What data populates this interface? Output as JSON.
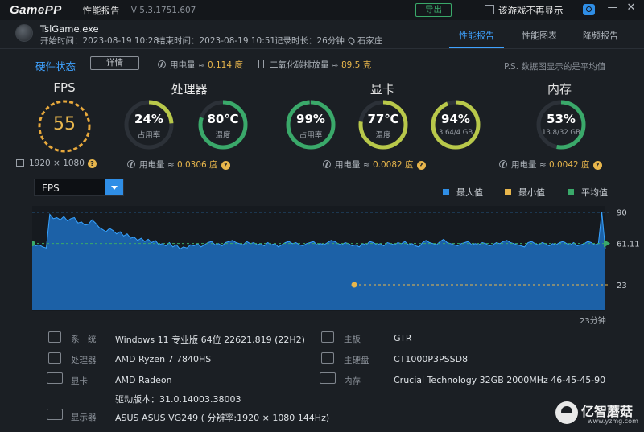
{
  "titlebar": {
    "logo": "GamePP",
    "title": "性能报告",
    "version": "V 5.3.1751.607",
    "export_label": "导出",
    "hide_label": "该游戏不再显示",
    "minimize": "—",
    "close": "✕"
  },
  "game": {
    "name": "TslGame.exe",
    "start": "开始时间：2023-08-19 10:28",
    "end": "结束时间：2023-08-19 10:51",
    "duration": "记录时长：26分钟",
    "location": "石家庄"
  },
  "tabs": [
    {
      "label": "性能报告"
    },
    {
      "label": "性能图表"
    },
    {
      "label": "降频报告"
    }
  ],
  "hardware": {
    "title": "硬件状态",
    "detail_label": "详情",
    "power_text": "用电量 ≈ ",
    "power_value": "0.114 度",
    "co2_text": "二氧化碳排放量 ≈ ",
    "co2_value": "89.5 克",
    "note": "P.S. 数据图显示的是平均值"
  },
  "sections": {
    "fps": "FPS",
    "cpu": "处理器",
    "gpu": "显卡",
    "mem": "内存"
  },
  "gauges": {
    "fps": {
      "value": "55"
    },
    "cpu_usage": {
      "value": "24%",
      "label": "占用率",
      "fraction": 0.24
    },
    "cpu_temp": {
      "value": "80℃",
      "label": "温度",
      "fraction": 0.8
    },
    "gpu_usage": {
      "value": "99%",
      "label": "占用率",
      "fraction": 0.99
    },
    "gpu_temp": {
      "value": "77℃",
      "label": "温度",
      "fraction": 0.77
    },
    "vram": {
      "value": "94%",
      "label": "3.64/4 GB",
      "fraction": 0.94
    },
    "mem": {
      "value": "53%",
      "label": "13.8/32 GB",
      "fraction": 0.53
    }
  },
  "resolution": "1920 × 1080",
  "power": {
    "label": "用电量 ≈ ",
    "cpu": "0.0306 度",
    "gpu": "0.0082 度",
    "mem": "0.0042 度"
  },
  "chart": {
    "selector": "FPS",
    "legend": [
      {
        "label": "最大值",
        "color": "#2f8ee6"
      },
      {
        "label": "最小值",
        "color": "#e8b64c"
      },
      {
        "label": "平均值",
        "color": "#3aa96a"
      }
    ],
    "time_label": "23分钟"
  },
  "chart_data": {
    "type": "area",
    "series": [
      {
        "name": "FPS",
        "values": [
          61,
          59,
          60,
          58,
          57,
          88,
          84,
          85,
          83,
          86,
          82,
          84,
          85,
          80,
          81,
          78,
          79,
          83,
          80,
          76,
          74,
          72,
          75,
          73,
          70,
          72,
          68,
          70,
          66,
          67,
          64,
          66,
          63,
          65,
          62,
          64,
          60,
          61,
          59,
          62,
          58,
          60,
          56,
          58,
          57,
          60,
          59,
          61,
          58,
          60,
          62,
          63,
          60,
          61,
          59,
          62,
          63,
          64,
          62,
          61,
          60,
          63,
          61,
          62,
          60,
          61,
          59,
          62,
          60,
          61,
          58,
          60,
          62,
          63,
          61,
          62,
          60,
          59,
          61,
          62,
          63,
          60,
          61,
          60,
          62,
          64,
          63,
          61,
          60,
          62,
          61,
          59,
          60,
          58,
          61,
          60,
          63,
          62,
          60,
          61,
          59,
          62,
          61,
          60,
          62,
          61,
          63,
          60,
          61,
          59,
          58,
          62,
          64,
          62,
          61,
          60,
          63,
          65,
          62,
          61,
          60,
          59,
          61,
          62,
          63,
          60,
          61,
          60,
          62,
          61,
          59,
          60,
          62,
          61,
          63,
          64,
          62,
          61,
          60,
          59,
          58,
          62,
          63,
          61,
          60,
          62,
          61,
          59,
          61,
          60,
          62,
          63,
          61,
          60,
          62,
          59,
          60,
          61,
          63,
          62,
          60,
          61,
          90,
          56
        ]
      }
    ],
    "y_max": 90,
    "y_avg": 61.11,
    "y_min": 23,
    "ylim": [
      0,
      95
    ],
    "ticks": [
      "90",
      "61.11",
      "23"
    ]
  },
  "info": [
    {
      "key": "系　统",
      "value": "Windows 11 专业版 64位 22621.819 (22H2)"
    },
    {
      "key": "处理器",
      "value": "AMD Ryzen 7 7840HS"
    },
    {
      "key": "显卡",
      "value": "AMD Radeon"
    },
    {
      "key": "",
      "value": "驱动版本：31.0.14003.38003"
    },
    {
      "key": "显示器",
      "value": "ASUS ASUS VG249 ( 分辨率:1920 × 1080 144Hz)"
    },
    {
      "key": "主板",
      "value": "GTR"
    },
    {
      "key": "主硬盘",
      "value": "CT1000P3PSSD8"
    },
    {
      "key": "内存",
      "value": "Crucial Technology 32GB 2000MHz 46-45-45-90"
    }
  ],
  "watermark": {
    "title": "亿智蘑菇",
    "url": "www.yzmg.com"
  }
}
